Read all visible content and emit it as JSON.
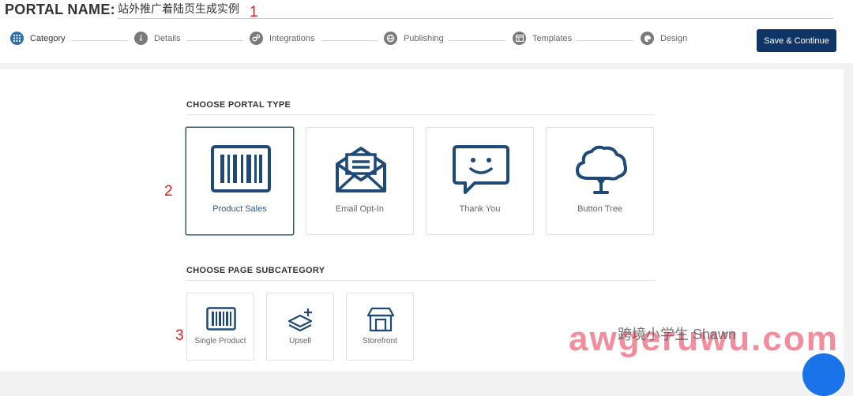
{
  "header": {
    "portal_label": "PORTAL NAME:",
    "portal_name": "站外推广着陆页生成实例",
    "save_label": "Save & Continue"
  },
  "steps": [
    {
      "label": "Category",
      "icon": "grid-icon",
      "active": true
    },
    {
      "label": "Details",
      "icon": "info-icon",
      "active": false
    },
    {
      "label": "Integrations",
      "icon": "gears-icon",
      "active": false
    },
    {
      "label": "Publishing",
      "icon": "globe-icon",
      "active": false
    },
    {
      "label": "Templates",
      "icon": "template-icon",
      "active": false
    },
    {
      "label": "Design",
      "icon": "palette-icon",
      "active": false
    }
  ],
  "annotations": [
    "1",
    "2",
    "3"
  ],
  "portal_type": {
    "title": "CHOOSE PORTAL TYPE",
    "cards": [
      {
        "label": "Product Sales",
        "icon": "barcode-icon",
        "selected": true
      },
      {
        "label": "Email Opt-In",
        "icon": "envelope-icon",
        "selected": false
      },
      {
        "label": "Thank You",
        "icon": "smiley-chat-icon",
        "selected": false
      },
      {
        "label": "Button Tree",
        "icon": "tree-icon",
        "selected": false
      }
    ]
  },
  "subcategory": {
    "title": "CHOOSE PAGE SUBCATEGORY",
    "cards": [
      {
        "label": "Single Product",
        "icon": "barcode-icon"
      },
      {
        "label": "Upsell",
        "icon": "layers-plus-icon"
      },
      {
        "label": "Storefront",
        "icon": "store-icon"
      }
    ]
  },
  "watermark": {
    "text": "awgeruwu.com",
    "sub": "跨境小学生 Shawn"
  },
  "colors": {
    "primary": "#0e3566",
    "active_step": "#2c6fb0",
    "icon": "#1f4a78",
    "annotation": "#e02020"
  }
}
